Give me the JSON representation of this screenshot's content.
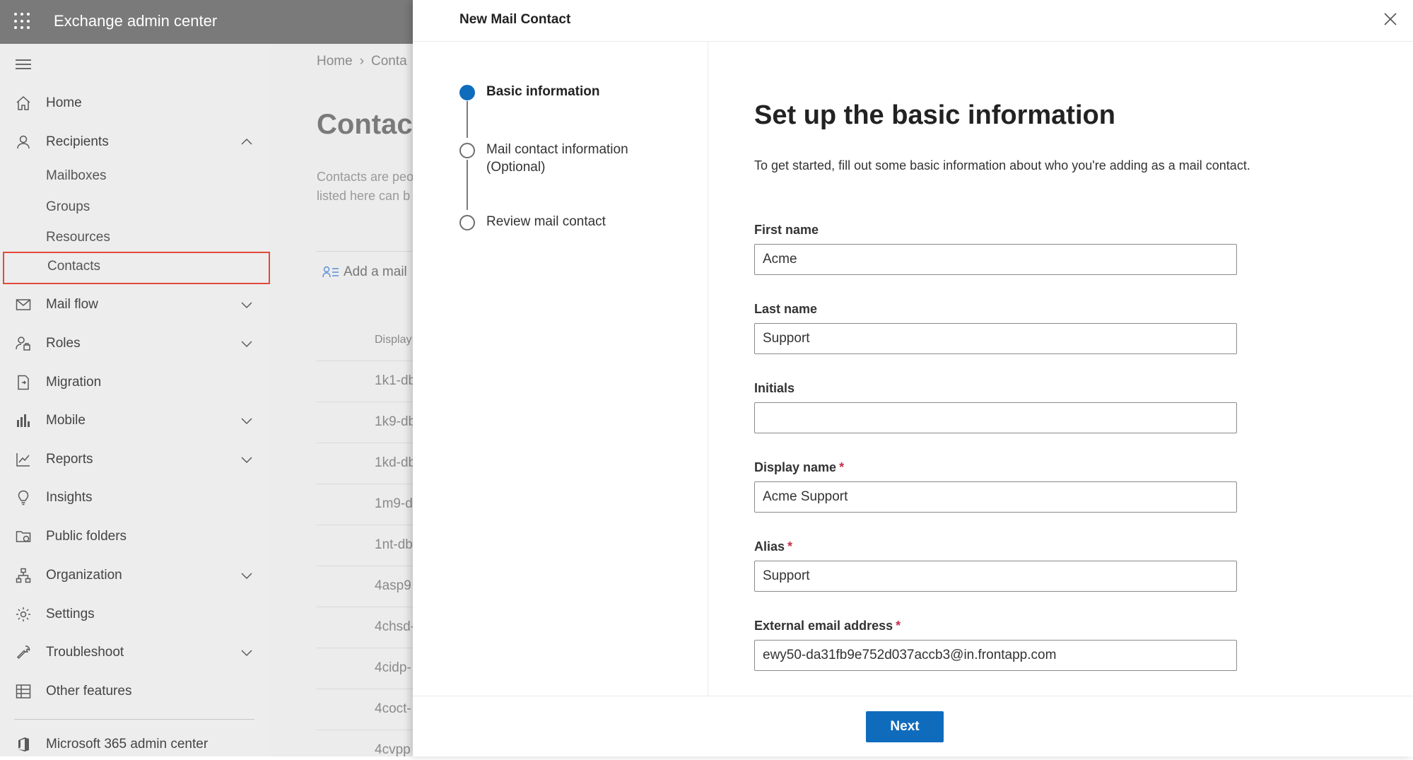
{
  "header": {
    "app_title": "Exchange admin center"
  },
  "nav": {
    "items": [
      {
        "label": "Home",
        "icon": "home-icon"
      },
      {
        "label": "Recipients",
        "icon": "person-icon",
        "expanded": true
      },
      {
        "label": "Mail flow",
        "icon": "mail-icon"
      },
      {
        "label": "Roles",
        "icon": "roles-icon"
      },
      {
        "label": "Migration",
        "icon": "migration-icon"
      },
      {
        "label": "Mobile",
        "icon": "mobile-icon"
      },
      {
        "label": "Reports",
        "icon": "reports-icon"
      },
      {
        "label": "Insights",
        "icon": "lightbulb-icon"
      },
      {
        "label": "Public folders",
        "icon": "folder-icon"
      },
      {
        "label": "Organization",
        "icon": "organization-icon"
      },
      {
        "label": "Settings",
        "icon": "gear-icon"
      },
      {
        "label": "Troubleshoot",
        "icon": "wrench-icon"
      },
      {
        "label": "Other features",
        "icon": "grid-icon"
      },
      {
        "label": "Microsoft 365 admin center",
        "icon": "office-icon"
      }
    ],
    "recipients_sub": [
      "Mailboxes",
      "Groups",
      "Resources",
      "Contacts"
    ],
    "selected": "Contacts"
  },
  "background_page": {
    "breadcrumb": [
      "Home",
      "Conta"
    ],
    "heading": "Contact",
    "description_lines": [
      "Contacts are peo",
      "listed here can b"
    ],
    "add_command": "Add a mail",
    "column_header": "Display",
    "rows": [
      "1k1-db",
      "1k9-db",
      "1kd-db",
      "1m9-d",
      "1nt-db",
      "4asp9",
      "4chsd-",
      "4cidp-",
      "4coct-",
      "4cvpp"
    ]
  },
  "panel": {
    "title": "New Mail Contact",
    "steps": [
      {
        "label": "Basic information",
        "state": "active"
      },
      {
        "label": "Mail contact information",
        "label2": "(Optional)",
        "state": "pending"
      },
      {
        "label": "Review mail contact",
        "state": "pending"
      }
    ],
    "form": {
      "heading": "Set up the basic information",
      "description": "To get started, fill out some basic information about who you're adding as a mail contact.",
      "first_name": {
        "label": "First name",
        "value": "Acme"
      },
      "last_name": {
        "label": "Last name",
        "value": "Support"
      },
      "initials": {
        "label": "Initials",
        "value": ""
      },
      "display_name": {
        "label": "Display name",
        "value": "Acme Support",
        "required_mark": "*"
      },
      "alias": {
        "label": "Alias",
        "value": "Support",
        "required_mark": "*"
      },
      "external_email": {
        "label": "External email address",
        "value": "ewy50-da31fb9e752d037accb3@in.frontapp.com",
        "required_mark": "*"
      }
    },
    "next_label": "Next"
  },
  "colors": {
    "accent": "#0f6cbd",
    "selection_outline": "#e4493b",
    "required": "#c4314b"
  }
}
